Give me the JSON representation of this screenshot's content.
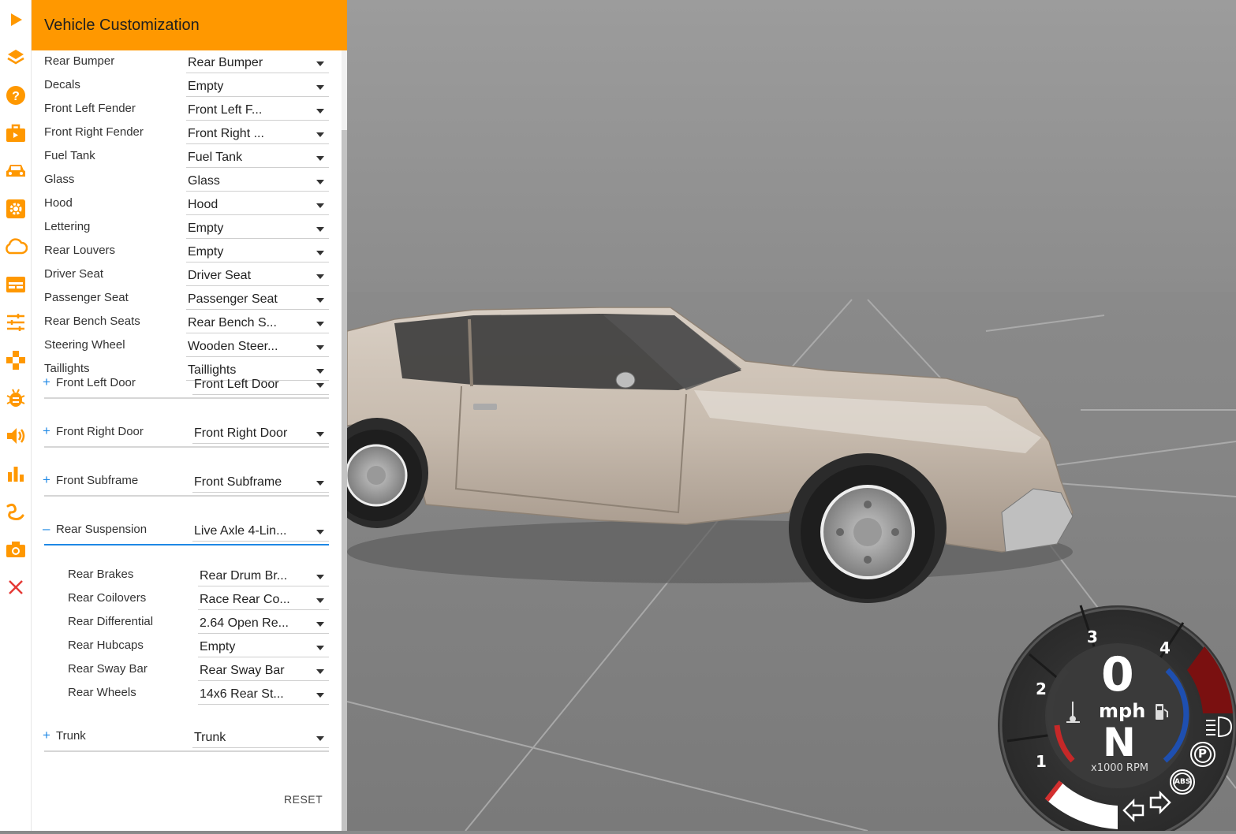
{
  "panel": {
    "title": "Vehicle Customization",
    "reset_label": "RESET"
  },
  "parts_top": [
    {
      "label": "Rear Bumper",
      "value": "Rear Bumper"
    },
    {
      "label": "Decals",
      "value": "Empty"
    },
    {
      "label": "Front Left Fender",
      "value": "Front Left F..."
    },
    {
      "label": "Front Right Fender",
      "value": "Front Right ..."
    },
    {
      "label": "Fuel Tank",
      "value": "Fuel Tank"
    },
    {
      "label": "Glass",
      "value": "Glass"
    },
    {
      "label": "Hood",
      "value": "Hood"
    },
    {
      "label": "Lettering",
      "value": "Empty"
    },
    {
      "label": "Rear Louvers",
      "value": "Empty"
    },
    {
      "label": "Driver Seat",
      "value": "Driver Seat"
    },
    {
      "label": "Passenger Seat",
      "value": "Passenger Seat"
    },
    {
      "label": "Rear Bench Seats",
      "value": "Rear Bench S..."
    },
    {
      "label": "Steering Wheel",
      "value": "Wooden Steer..."
    },
    {
      "label": "Taillights",
      "value": "Taillights"
    }
  ],
  "sections": [
    {
      "toggle": "+",
      "label": "Front Left Door",
      "value": "Front Left Door"
    },
    {
      "toggle": "+",
      "label": "Front Right Door",
      "value": "Front Right Door"
    },
    {
      "toggle": "+",
      "label": "Front Subframe",
      "value": "Front Subframe"
    },
    {
      "toggle": "–",
      "label": "Rear Suspension",
      "value": "Live Axle 4-Lin..."
    },
    {
      "toggle": "+",
      "label": "Trunk",
      "value": "Trunk"
    }
  ],
  "rear_suspension_parts": [
    {
      "label": "Rear Brakes",
      "value": "Rear Drum Br..."
    },
    {
      "label": "Rear Coilovers",
      "value": "Race Rear Co..."
    },
    {
      "label": "Rear Differential",
      "value": "2.64 Open Re..."
    },
    {
      "label": "Rear Hubcaps",
      "value": "Empty"
    },
    {
      "label": "Rear Sway Bar",
      "value": "Rear Sway Bar"
    },
    {
      "label": "Rear Wheels",
      "value": "14x6 Rear St..."
    }
  ],
  "sidebar_icons": [
    "play-icon",
    "layers-icon",
    "help-icon",
    "briefcase-icon",
    "car-icon",
    "settings-gear-icon",
    "cloud-icon",
    "dashboard-card-icon",
    "tune-sliders-icon",
    "gamepad-icon",
    "bug-icon",
    "volume-icon",
    "bar-chart-icon",
    "route-icon",
    "camera-icon",
    "close-icon"
  ],
  "dashboard": {
    "speed": "0",
    "speed_unit": "mph",
    "gear": "N",
    "rpm_label": "x1000 RPM",
    "ticks": [
      "1",
      "2",
      "3",
      "4"
    ],
    "abs_label": "ABS",
    "parking_label": "P"
  },
  "colors": {
    "accent": "#ff9800",
    "section_active": "#1e88e5",
    "car_body": "#c9bdb0",
    "redline": "#8b1515"
  }
}
